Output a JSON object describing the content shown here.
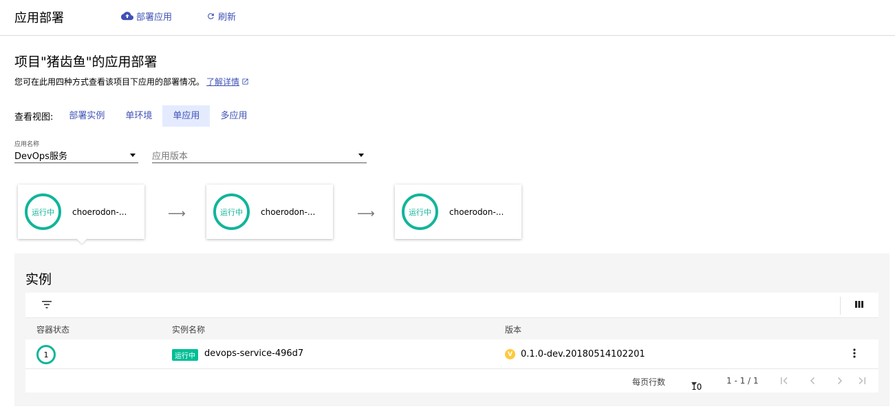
{
  "header": {
    "title": "应用部署",
    "deploy_label": "部署应用",
    "refresh_label": "刷新"
  },
  "page": {
    "title": "项目\"猪齿鱼\"的应用部署",
    "description": "您可在此用四种方式查看该项目下应用的部署情况。",
    "learn_more": "了解详情"
  },
  "views": {
    "label": "查看视图:",
    "tabs": [
      "部署实例",
      "单环境",
      "单应用",
      "多应用"
    ],
    "active": "单应用"
  },
  "filters": {
    "app_name_label": "应用名称",
    "app_name_value": "DevOps服务",
    "version_placeholder": "应用版本"
  },
  "env_cards": [
    {
      "status": "运行中",
      "name": "choerodon-..."
    },
    {
      "status": "运行中",
      "name": "choerodon-..."
    },
    {
      "status": "运行中",
      "name": "choerodon-..."
    }
  ],
  "arrow_glyph": "⟶",
  "instances": {
    "title": "实例",
    "columns": {
      "status": "容器状态",
      "name": "实例名称",
      "version": "版本"
    },
    "rows": [
      {
        "count": "1",
        "status_tag": "运行中",
        "name": "devops-service-496d7",
        "version_icon": "V",
        "version": "0.1.0-dev.20180514102201"
      }
    ],
    "footer": {
      "rows_per_page_label": "每页行数",
      "page_size": "10",
      "range": "1 - 1 / 1"
    }
  },
  "colors": {
    "accent": "#3f51b5",
    "running": "#11b59a",
    "status_tag": "#00bf96",
    "version_icon": "#ffc93d",
    "active_tab_bg": "#e5ebff"
  }
}
